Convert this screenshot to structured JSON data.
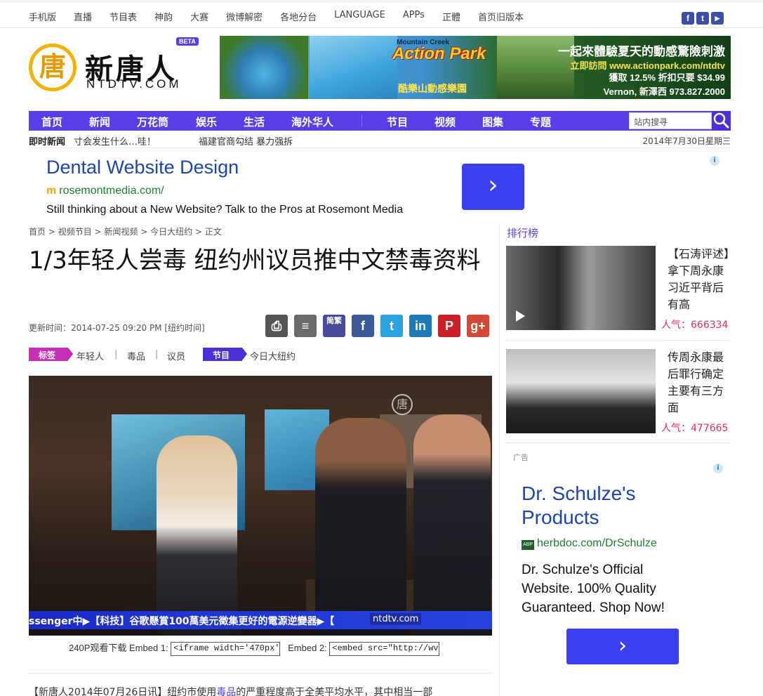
{
  "topbar": {
    "links": [
      "手机版",
      "直播",
      "节目表",
      "神韵",
      "大赛",
      "微博解密",
      "各地分台",
      "LANGUAGE",
      "APPs",
      "正體",
      "首页旧版本"
    ],
    "social": [
      {
        "icon": "facebook-icon",
        "glyph": "f",
        "color": "#3b4ea8"
      },
      {
        "icon": "twitter-icon",
        "glyph": "t",
        "color": "#3b4ea8"
      },
      {
        "icon": "youtube-icon",
        "glyph": "▶",
        "color": "#3b4ea8"
      }
    ]
  },
  "logo": {
    "emblem": "唐",
    "name": "新唐人",
    "domain": "NTDTV.COM",
    "badge": "BETA"
  },
  "banner": {
    "brand_top": "Mountain Creek",
    "brand_main": "Action Park",
    "brand_cn": "酷樂山動感樂園",
    "line1": "一起來體驗夏天的動感驚險刺激",
    "line2": "立即訪問 www.actionpark.com/ntdtv",
    "line3": "獲取 12.5% 折扣只要 $34.99",
    "line4": "Vernon, 新澤西 973.827.2000"
  },
  "nav": {
    "items": [
      "首页",
      "新闻",
      "万花筒",
      "娱乐",
      "生活",
      "海外华人",
      "节目",
      "视频",
      "图集",
      "专题"
    ],
    "search_placeholder": "站内搜寻"
  },
  "ticker": {
    "label": "即时新闻",
    "items": [
      "寸会发生什么…哇！",
      "福建官商勾结 暴力强拆"
    ],
    "date": "2014年7月30日星期三"
  },
  "text_ad": {
    "title": "Dental Website Design",
    "url": "rosemontmedia.com/",
    "description": "Still thinking about a New Website? Talk to the Pros at Rosemont Media",
    "button": "›"
  },
  "breadcrumb": [
    "首页",
    "视频节目",
    "新闻视频",
    "今日大纽约",
    "正文"
  ],
  "article": {
    "headline": "1/3年轻人尝毒 纽约州议员推中文禁毒资料",
    "updated": "更新时间：2014-07-25 09:20 PM [纽约时间]",
    "tags_label": "标签",
    "tags": [
      "年轻人",
      "毒品",
      "议员"
    ],
    "program_label": "节目",
    "program": "今日大纽约",
    "share": [
      {
        "icon": "print-icon",
        "glyph": "⎙",
        "color": "#555555"
      },
      {
        "icon": "comment-icon",
        "glyph": "≡",
        "color": "#6a6a6a"
      },
      {
        "icon": "simplified-traditional-icon",
        "glyph": "简繁",
        "color": "#4a4a9a"
      },
      {
        "icon": "facebook-share-icon",
        "glyph": "f",
        "color": "#3b5b98"
      },
      {
        "icon": "twitter-share-icon",
        "glyph": "t",
        "color": "#2aa3e0"
      },
      {
        "icon": "linkedin-share-icon",
        "glyph": "in",
        "color": "#1f7bb5"
      },
      {
        "icon": "pinterest-share-icon",
        "glyph": "P",
        "color": "#cb2027"
      },
      {
        "icon": "googleplus-share-icon",
        "glyph": "g+",
        "color": "#d34836"
      }
    ],
    "video_ticker": "ssenger中▶【科技】谷歌懸賞100萬美元徵集更好的電源逆變器▶【",
    "video_watermark": "ntdtv.com",
    "video_emblem": "唐",
    "embed_label": "240P观看下载",
    "embed1_label": "Embed 1:",
    "embed1_value": "<iframe width='470px'",
    "embed2_label": "Embed 2:",
    "embed2_value": "<embed src=\"http://wv",
    "body_start": "【新唐人2014年07月26日讯】纽约市使用",
    "body_link": "毒品",
    "body_end": "的严重程度高于全美平均水平，其中相当一部"
  },
  "sidebar": {
    "rank_title": "排行榜",
    "ranks": [
      {
        "text": "【石涛评述】拿下周永康 习近平背后有高",
        "popularity": "人气：666334"
      },
      {
        "text": "传周永康最后罪行确定 主要有三方面",
        "popularity": "人气：477665"
      }
    ],
    "ad_label": "广告",
    "ad": {
      "title": "Dr. Schulze's Products",
      "url_icon": "ABP",
      "url": "herbdoc.com/DrSchulze",
      "description": "Dr. Schulze's Official Website. 100% Quality Guaranteed. Shop Now!",
      "button": "›"
    }
  }
}
